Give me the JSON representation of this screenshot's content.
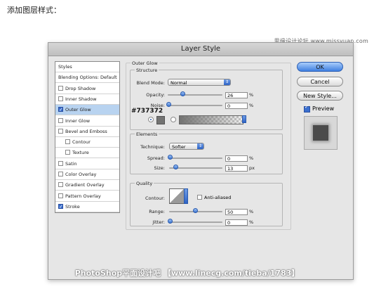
{
  "page": {
    "heading": "添加图层样式：",
    "watermark_top": "思缘设计论坛 www.missyuan.com",
    "watermark_bottom": "PhotoShop平面设计吧 【www.linecg.com/tieba/1783】"
  },
  "dialog": {
    "title": "Layer Style",
    "styles_list": [
      {
        "label": "Styles",
        "checkbox": false,
        "checked": false,
        "selected": false
      },
      {
        "label": "Blending Options: Default",
        "checkbox": false,
        "checked": false,
        "selected": false
      },
      {
        "label": "Drop Shadow",
        "checkbox": true,
        "checked": false,
        "selected": false
      },
      {
        "label": "Inner Shadow",
        "checkbox": true,
        "checked": false,
        "selected": false
      },
      {
        "label": "Outer Glow",
        "checkbox": true,
        "checked": true,
        "selected": true
      },
      {
        "label": "Inner Glow",
        "checkbox": true,
        "checked": false,
        "selected": false
      },
      {
        "label": "Bevel and Emboss",
        "checkbox": true,
        "checked": false,
        "selected": false
      },
      {
        "label": "Contour",
        "checkbox": true,
        "checked": false,
        "selected": false,
        "indent": true
      },
      {
        "label": "Texture",
        "checkbox": true,
        "checked": false,
        "selected": false,
        "indent": true
      },
      {
        "label": "Satin",
        "checkbox": true,
        "checked": false,
        "selected": false
      },
      {
        "label": "Color Overlay",
        "checkbox": true,
        "checked": false,
        "selected": false
      },
      {
        "label": "Gradient Overlay",
        "checkbox": true,
        "checked": false,
        "selected": false
      },
      {
        "label": "Pattern Overlay",
        "checkbox": true,
        "checked": false,
        "selected": false
      },
      {
        "label": "Stroke",
        "checkbox": true,
        "checked": true,
        "selected": false
      }
    ],
    "outer_glow": {
      "section_title": "Outer Glow",
      "structure": {
        "title": "Structure",
        "blend_mode_label": "Blend Mode:",
        "blend_mode": "Normal",
        "opacity_label": "Opacity:",
        "opacity": "26",
        "opacity_unit": "%",
        "noise_label": "Noise:",
        "noise": "0",
        "noise_unit": "%",
        "color_annotation": "#737372",
        "color_hex": "#737372"
      },
      "elements": {
        "title": "Elements",
        "technique_label": "Technique:",
        "technique": "Softer",
        "spread_label": "Spread:",
        "spread": "0",
        "spread_unit": "%",
        "size_label": "Size:",
        "size": "13",
        "size_unit": "px"
      },
      "quality": {
        "title": "Quality",
        "contour_label": "Contour:",
        "anti_aliased_label": "Anti-aliased",
        "range_label": "Range:",
        "range": "50",
        "range_unit": "%",
        "jitter_label": "Jitter:",
        "jitter": "0",
        "jitter_unit": "%"
      }
    },
    "buttons": {
      "ok": "OK",
      "cancel": "Cancel",
      "new_style": "New Style...",
      "preview_label": "Preview"
    },
    "preview_checked": true
  }
}
